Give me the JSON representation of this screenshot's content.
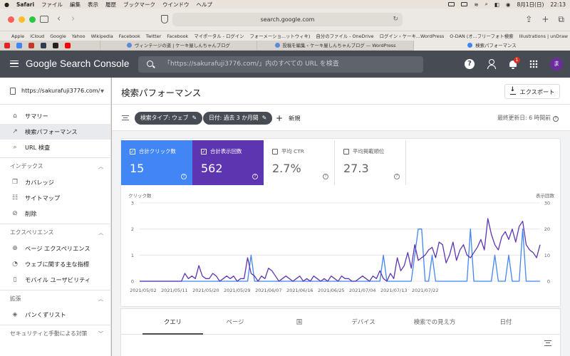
{
  "menubar": {
    "app": "Safari",
    "items": [
      "ファイル",
      "編集",
      "表示",
      "履歴",
      "ブックマーク",
      "ウインドウ",
      "ヘルプ"
    ],
    "date": "8月1日(日)",
    "time": "22:13"
  },
  "safari": {
    "url": "search.google.com",
    "favorites": [
      "Apple",
      "iCloud",
      "Google",
      "Yahoo",
      "Wikipedia",
      "Facebook",
      "Twitter",
      "Facebook",
      "マイポータル - ログイン",
      "フォーメーショ...ットウィキ)",
      "自分のファイル - OneDrive",
      "ログイン ‹ ケーキ...WordPress",
      "O-DAN (オ...フリーフォト検索",
      "Illustrations | unDraw"
    ],
    "tabs": [
      "ヴィンテージの道 | ケーキ屋しんちゃんブログ",
      "投稿を編集 ‹ ケーキ屋しんちゃんブログ — WordPress",
      "検索パフォーマンス"
    ]
  },
  "header": {
    "brand": "Google Search Console",
    "search_placeholder": "「https://sakurafuji3776.com/」内のすべての URL を検査",
    "notification_count": "1",
    "avatar_letter": "ま"
  },
  "sidebar": {
    "property": "https://sakurafuji3776.com/",
    "items": [
      {
        "label": "サマリー",
        "icon": "home-icon"
      },
      {
        "label": "検索パフォーマンス",
        "icon": "trending-icon"
      },
      {
        "label": "URL 検査",
        "icon": "search-icon"
      }
    ],
    "sections": [
      {
        "title": "インデックス",
        "items": [
          {
            "label": "カバレッジ",
            "icon": "file-copy-icon"
          },
          {
            "label": "サイトマップ",
            "icon": "sitemap-icon"
          },
          {
            "label": "削除",
            "icon": "eye-off-icon"
          }
        ]
      },
      {
        "title": "エクスペリエンス",
        "items": [
          {
            "label": "ページ エクスペリエンス",
            "icon": "plus-circle-icon"
          },
          {
            "label": "ウェブに関する主な指標",
            "icon": "speed-icon"
          },
          {
            "label": "モバイル ユーザビリティ",
            "icon": "phone-icon"
          }
        ]
      },
      {
        "title": "拡張",
        "items": [
          {
            "label": "パンくずリスト",
            "icon": "layers-icon"
          }
        ]
      },
      {
        "title": "セキュリティと手動による対策",
        "items": []
      }
    ]
  },
  "page": {
    "title": "検索パフォーマンス",
    "export_label": "エクスポート",
    "filters": [
      "検索タイプ: ウェブ",
      "日付: 過去 3 か月間"
    ],
    "new_label": "新規",
    "last_updated": "最終更新日: 6 時間前"
  },
  "metrics": [
    {
      "label": "合計クリック数",
      "value": "15",
      "checked": true,
      "color": "#4285f4"
    },
    {
      "label": "合計表示回数",
      "value": "562",
      "checked": true,
      "color": "#5e35b1"
    },
    {
      "label": "平均 CTR",
      "value": "2.7%",
      "checked": false
    },
    {
      "label": "平均掲載順位",
      "value": "27.3",
      "checked": false
    }
  ],
  "chart_data": {
    "type": "line",
    "ylabel_left": "クリック数",
    "ylabel_right": "表示回数",
    "y_left_ticks": [
      "0",
      "1",
      "2",
      "3"
    ],
    "y_right_ticks": [
      "0",
      "10",
      "20",
      "30"
    ],
    "ylim_left": [
      0,
      3
    ],
    "ylim_right": [
      0,
      30
    ],
    "x_tick_labels": [
      "2021/05/02",
      "2021/05/11",
      "2021/05/20",
      "2021/05/29",
      "2021/06/07",
      "2021/06/16",
      "2021/06/25",
      "2021/07/04",
      "2021/07/13",
      "2021/07/22"
    ],
    "x_start": "2021/05/01",
    "series": [
      {
        "name": "合計クリック数",
        "axis": "left",
        "color": "#4285f4",
        "values": [
          0,
          0,
          0,
          0,
          0,
          0,
          0,
          0,
          0,
          0,
          0,
          0,
          0,
          0,
          0,
          0,
          0,
          0,
          0,
          0,
          0,
          0,
          0,
          0,
          0,
          0,
          0,
          0,
          0,
          0,
          0,
          0,
          1,
          0,
          0,
          0,
          0,
          0,
          0,
          0,
          0,
          0,
          0,
          0,
          0,
          0,
          0,
          0,
          0,
          0,
          0,
          0,
          0,
          0,
          0,
          0,
          0,
          0,
          0,
          0,
          0,
          0,
          0,
          0,
          0,
          0,
          0,
          0,
          0,
          0,
          1,
          0,
          0,
          0,
          0,
          0,
          0,
          0,
          0,
          1,
          2,
          2,
          0,
          0,
          1,
          0,
          0,
          0,
          0,
          0,
          0,
          0,
          0,
          0,
          0,
          2,
          0,
          0,
          0,
          0,
          0,
          0,
          1,
          0,
          0,
          0,
          1,
          0,
          0,
          0,
          2,
          0,
          0,
          0,
          0,
          0
        ]
      },
      {
        "name": "合計表示回数",
        "axis": "right",
        "color": "#5e35b1",
        "values": [
          0,
          0,
          0,
          0,
          0,
          0,
          0,
          0,
          0,
          0,
          0,
          0,
          0,
          3,
          1,
          2,
          1,
          6,
          2,
          1,
          1,
          3,
          2,
          0,
          1,
          2,
          1,
          2,
          0,
          1,
          1,
          9,
          3,
          2,
          0,
          2,
          1,
          5,
          4,
          2,
          0,
          1,
          2,
          1,
          0,
          1,
          2,
          0,
          1,
          0,
          2,
          1,
          0,
          1,
          0,
          2,
          1,
          0,
          2,
          1,
          1,
          0,
          0,
          1,
          2,
          1,
          0,
          2,
          1,
          4,
          1,
          0,
          3,
          1,
          9,
          4,
          6,
          11,
          5,
          14,
          8,
          9,
          10,
          12,
          13,
          9,
          15,
          14,
          7,
          10,
          15,
          8,
          12,
          14,
          10,
          9,
          11,
          13,
          16,
          12,
          24,
          18,
          14,
          12,
          17,
          19,
          16,
          20,
          15,
          21,
          23,
          14,
          12,
          11,
          9,
          14
        ]
      }
    ]
  },
  "table_tabs": [
    "クエリ",
    "ページ",
    "国",
    "デバイス",
    "検索での見え方",
    "日付"
  ],
  "colors": {
    "header_bg": "#474b53",
    "clicks": "#4285f4",
    "impressions": "#5e35b1"
  }
}
